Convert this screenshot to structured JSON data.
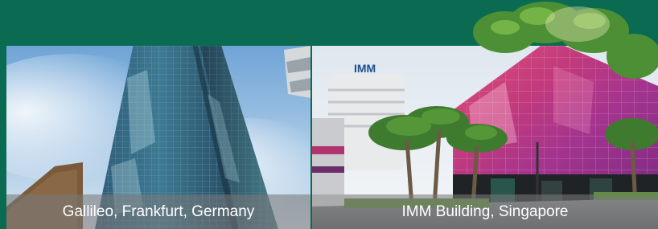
{
  "banner": {
    "background_color": "#0b6b52"
  },
  "panels": [
    {
      "caption": "Gallileo, Frankfurt, Germany",
      "image_subject": "glass-skyscraper"
    },
    {
      "caption": "IMM Building, Singapore",
      "image_subject": "imm-building-facade",
      "sign_text": "IMM"
    }
  ]
}
